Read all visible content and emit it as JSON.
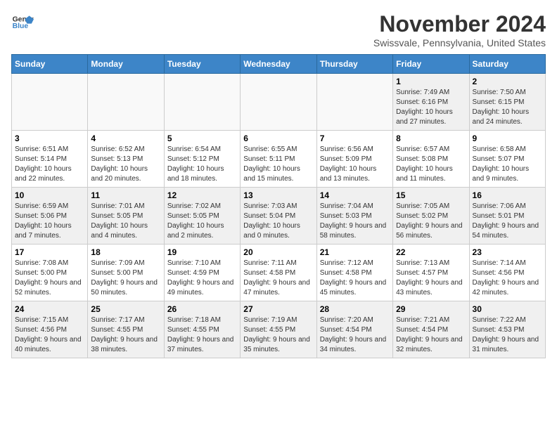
{
  "logo": {
    "line1": "General",
    "line2": "Blue"
  },
  "title": "November 2024",
  "location": "Swissvale, Pennsylvania, United States",
  "weekdays": [
    "Sunday",
    "Monday",
    "Tuesday",
    "Wednesday",
    "Thursday",
    "Friday",
    "Saturday"
  ],
  "weeks": [
    [
      {
        "day": "",
        "info": ""
      },
      {
        "day": "",
        "info": ""
      },
      {
        "day": "",
        "info": ""
      },
      {
        "day": "",
        "info": ""
      },
      {
        "day": "",
        "info": ""
      },
      {
        "day": "1",
        "info": "Sunrise: 7:49 AM\nSunset: 6:16 PM\nDaylight: 10 hours and 27 minutes."
      },
      {
        "day": "2",
        "info": "Sunrise: 7:50 AM\nSunset: 6:15 PM\nDaylight: 10 hours and 24 minutes."
      }
    ],
    [
      {
        "day": "3",
        "info": "Sunrise: 6:51 AM\nSunset: 5:14 PM\nDaylight: 10 hours and 22 minutes."
      },
      {
        "day": "4",
        "info": "Sunrise: 6:52 AM\nSunset: 5:13 PM\nDaylight: 10 hours and 20 minutes."
      },
      {
        "day": "5",
        "info": "Sunrise: 6:54 AM\nSunset: 5:12 PM\nDaylight: 10 hours and 18 minutes."
      },
      {
        "day": "6",
        "info": "Sunrise: 6:55 AM\nSunset: 5:11 PM\nDaylight: 10 hours and 15 minutes."
      },
      {
        "day": "7",
        "info": "Sunrise: 6:56 AM\nSunset: 5:09 PM\nDaylight: 10 hours and 13 minutes."
      },
      {
        "day": "8",
        "info": "Sunrise: 6:57 AM\nSunset: 5:08 PM\nDaylight: 10 hours and 11 minutes."
      },
      {
        "day": "9",
        "info": "Sunrise: 6:58 AM\nSunset: 5:07 PM\nDaylight: 10 hours and 9 minutes."
      }
    ],
    [
      {
        "day": "10",
        "info": "Sunrise: 6:59 AM\nSunset: 5:06 PM\nDaylight: 10 hours and 7 minutes."
      },
      {
        "day": "11",
        "info": "Sunrise: 7:01 AM\nSunset: 5:05 PM\nDaylight: 10 hours and 4 minutes."
      },
      {
        "day": "12",
        "info": "Sunrise: 7:02 AM\nSunset: 5:05 PM\nDaylight: 10 hours and 2 minutes."
      },
      {
        "day": "13",
        "info": "Sunrise: 7:03 AM\nSunset: 5:04 PM\nDaylight: 10 hours and 0 minutes."
      },
      {
        "day": "14",
        "info": "Sunrise: 7:04 AM\nSunset: 5:03 PM\nDaylight: 9 hours and 58 minutes."
      },
      {
        "day": "15",
        "info": "Sunrise: 7:05 AM\nSunset: 5:02 PM\nDaylight: 9 hours and 56 minutes."
      },
      {
        "day": "16",
        "info": "Sunrise: 7:06 AM\nSunset: 5:01 PM\nDaylight: 9 hours and 54 minutes."
      }
    ],
    [
      {
        "day": "17",
        "info": "Sunrise: 7:08 AM\nSunset: 5:00 PM\nDaylight: 9 hours and 52 minutes."
      },
      {
        "day": "18",
        "info": "Sunrise: 7:09 AM\nSunset: 5:00 PM\nDaylight: 9 hours and 50 minutes."
      },
      {
        "day": "19",
        "info": "Sunrise: 7:10 AM\nSunset: 4:59 PM\nDaylight: 9 hours and 49 minutes."
      },
      {
        "day": "20",
        "info": "Sunrise: 7:11 AM\nSunset: 4:58 PM\nDaylight: 9 hours and 47 minutes."
      },
      {
        "day": "21",
        "info": "Sunrise: 7:12 AM\nSunset: 4:58 PM\nDaylight: 9 hours and 45 minutes."
      },
      {
        "day": "22",
        "info": "Sunrise: 7:13 AM\nSunset: 4:57 PM\nDaylight: 9 hours and 43 minutes."
      },
      {
        "day": "23",
        "info": "Sunrise: 7:14 AM\nSunset: 4:56 PM\nDaylight: 9 hours and 42 minutes."
      }
    ],
    [
      {
        "day": "24",
        "info": "Sunrise: 7:15 AM\nSunset: 4:56 PM\nDaylight: 9 hours and 40 minutes."
      },
      {
        "day": "25",
        "info": "Sunrise: 7:17 AM\nSunset: 4:55 PM\nDaylight: 9 hours and 38 minutes."
      },
      {
        "day": "26",
        "info": "Sunrise: 7:18 AM\nSunset: 4:55 PM\nDaylight: 9 hours and 37 minutes."
      },
      {
        "day": "27",
        "info": "Sunrise: 7:19 AM\nSunset: 4:55 PM\nDaylight: 9 hours and 35 minutes."
      },
      {
        "day": "28",
        "info": "Sunrise: 7:20 AM\nSunset: 4:54 PM\nDaylight: 9 hours and 34 minutes."
      },
      {
        "day": "29",
        "info": "Sunrise: 7:21 AM\nSunset: 4:54 PM\nDaylight: 9 hours and 32 minutes."
      },
      {
        "day": "30",
        "info": "Sunrise: 7:22 AM\nSunset: 4:53 PM\nDaylight: 9 hours and 31 minutes."
      }
    ]
  ]
}
